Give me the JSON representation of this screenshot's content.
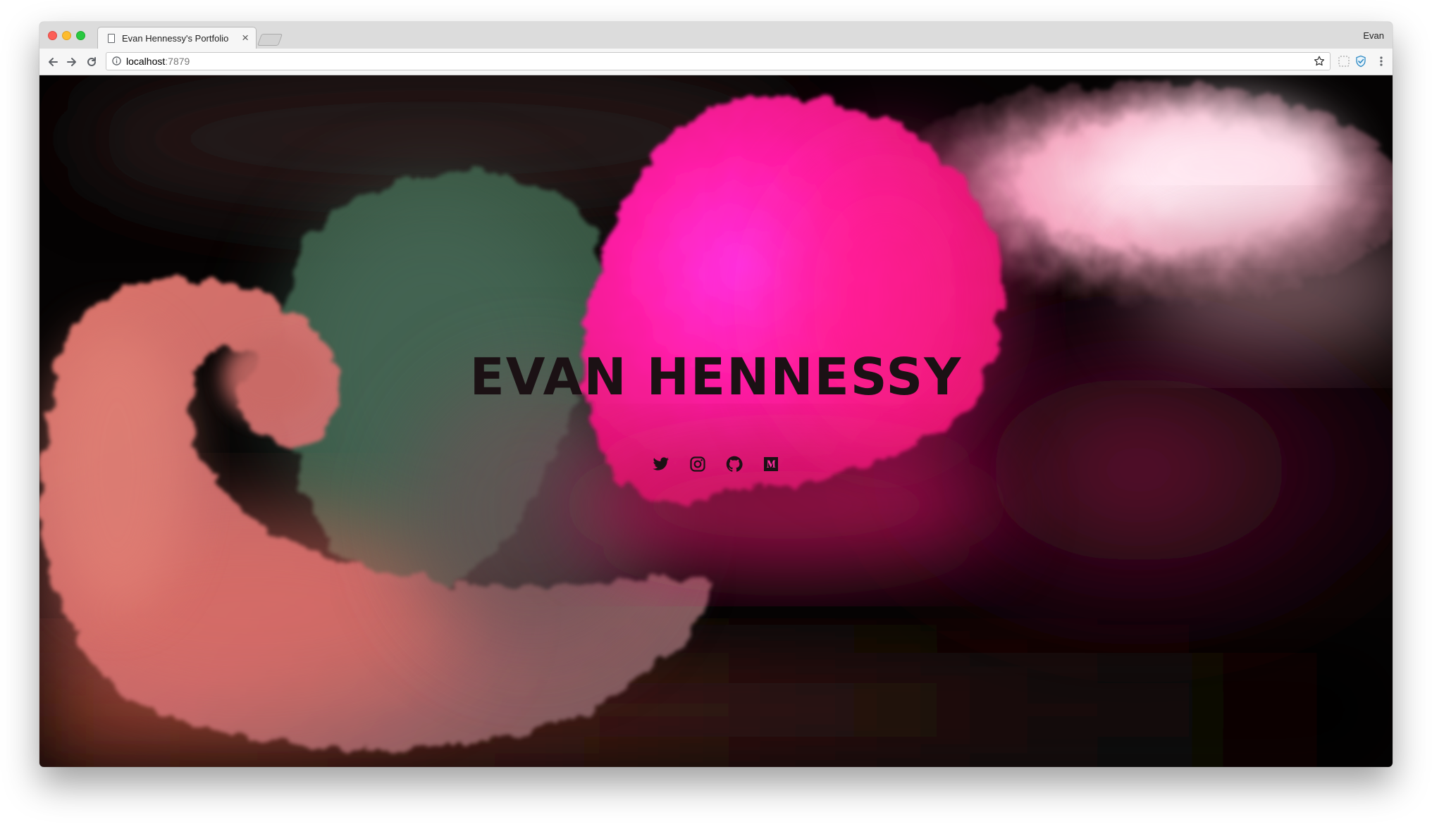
{
  "browser": {
    "tab_title": "Evan Hennessy's Portfolio",
    "tab_close": "×",
    "profile_name": "Evan",
    "url_host": "localhost",
    "url_port": ":7879"
  },
  "page": {
    "title": "EVAN HENNESSY",
    "social": [
      {
        "icon": "twitter-icon"
      },
      {
        "icon": "instagram-icon"
      },
      {
        "icon": "github-icon"
      },
      {
        "icon": "medium-icon"
      }
    ]
  },
  "colors": {
    "magenta": "#ff2ad8",
    "hot_pink": "#ff1f86",
    "teal_smoke": "#3b5a48",
    "salmon": "#e8736a",
    "title_ink": "#1b1114"
  }
}
